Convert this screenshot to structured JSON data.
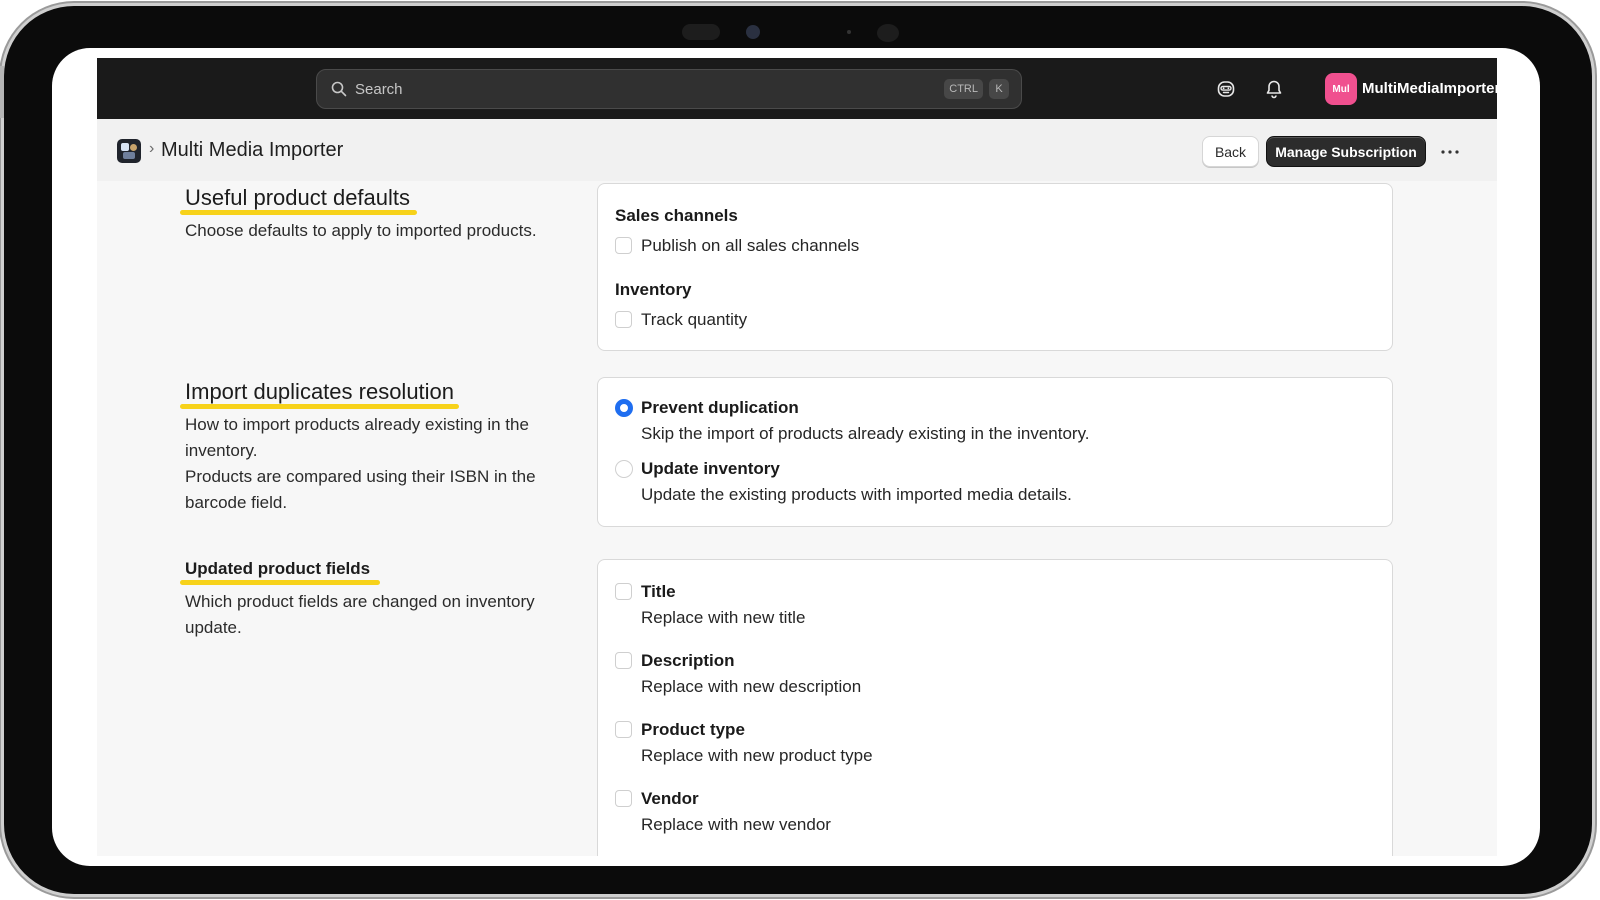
{
  "topbar": {
    "search_placeholder": "Search",
    "shortcut_ctrl": "CTRL",
    "shortcut_k": "K",
    "avatar_initials": "Mul",
    "store_name": "MultiMediaImporter",
    "avatar_color": "#f0508f"
  },
  "titlebar": {
    "title": "Multi Media Importer",
    "back_label": "Back",
    "manage_label": "Manage Subscription",
    "more_label": "···"
  },
  "sections": {
    "defaults": {
      "heading": "Useful product defaults",
      "description": "Choose defaults to apply to imported products.",
      "sales_channels_label": "Sales channels",
      "publish_label": "Publish on all sales channels",
      "inventory_label": "Inventory",
      "track_label": "Track quantity"
    },
    "duplicates": {
      "heading": "Import duplicates resolution",
      "description_1": "How to import products already existing in the inventory.",
      "description_2": "Products are compared using their ISBN in the barcode field.",
      "prevent_label": "Prevent duplication",
      "prevent_help": "Skip the import of products already existing in the inventory.",
      "update_label": "Update inventory",
      "update_help": "Update the existing products with imported media details.",
      "selected": "prevent"
    },
    "fields": {
      "heading": "Updated product fields",
      "description": "Which product fields are changed on inventory update.",
      "items": [
        {
          "label": "Title",
          "help": "Replace with new title"
        },
        {
          "label": "Description",
          "help": "Replace with new description"
        },
        {
          "label": "Product type",
          "help": "Replace with new product type"
        },
        {
          "label": "Vendor",
          "help": "Replace with new vendor"
        }
      ]
    }
  },
  "colors": {
    "highlight": "#f7d21a",
    "accent": "#1f6ef0",
    "topbar": "#1a1a1a"
  }
}
